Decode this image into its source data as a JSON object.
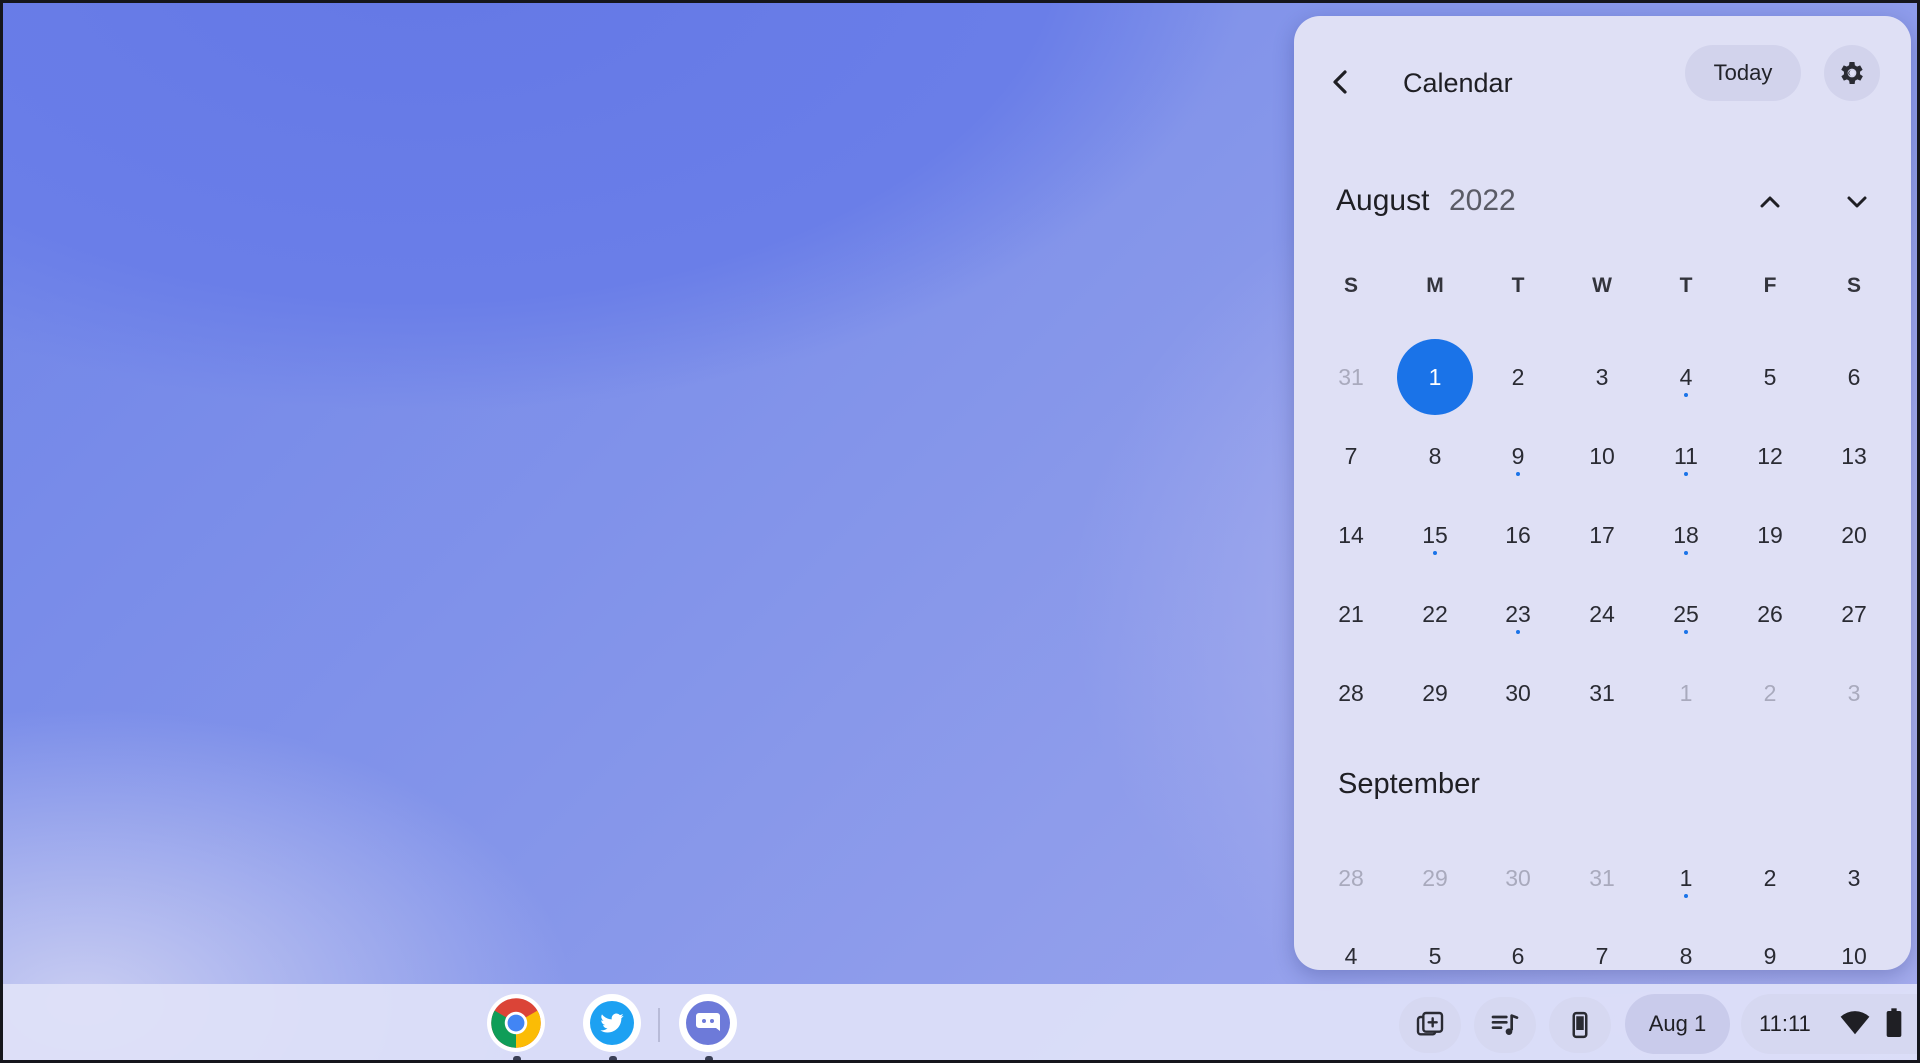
{
  "calendar": {
    "back_icon": "chevron-left-icon",
    "title": "Calendar",
    "today_label": "Today",
    "settings_icon": "gear-icon",
    "month": "August",
    "year": "2022",
    "prev_icon": "chevron-up-icon",
    "next_icon": "chevron-down-icon",
    "days_of_week": [
      "S",
      "M",
      "T",
      "W",
      "T",
      "F",
      "S"
    ],
    "august_weeks": [
      [
        {
          "d": "31",
          "muted": true
        },
        {
          "d": "1",
          "selected": true
        },
        {
          "d": "2"
        },
        {
          "d": "3"
        },
        {
          "d": "4",
          "event": true
        },
        {
          "d": "5"
        },
        {
          "d": "6"
        }
      ],
      [
        {
          "d": "7"
        },
        {
          "d": "8"
        },
        {
          "d": "9",
          "event": true
        },
        {
          "d": "10"
        },
        {
          "d": "11",
          "event": true
        },
        {
          "d": "12"
        },
        {
          "d": "13"
        }
      ],
      [
        {
          "d": "14"
        },
        {
          "d": "15",
          "event": true
        },
        {
          "d": "16"
        },
        {
          "d": "17"
        },
        {
          "d": "18",
          "event": true
        },
        {
          "d": "19"
        },
        {
          "d": "20"
        }
      ],
      [
        {
          "d": "21"
        },
        {
          "d": "22"
        },
        {
          "d": "23",
          "event": true
        },
        {
          "d": "24"
        },
        {
          "d": "25",
          "event": true
        },
        {
          "d": "26"
        },
        {
          "d": "27"
        }
      ],
      [
        {
          "d": "28"
        },
        {
          "d": "29"
        },
        {
          "d": "30"
        },
        {
          "d": "31"
        },
        {
          "d": "1",
          "muted": true
        },
        {
          "d": "2",
          "muted": true
        },
        {
          "d": "3",
          "muted": true
        }
      ]
    ],
    "next_month": "September",
    "september_weeks": [
      [
        {
          "d": "28",
          "muted": true
        },
        {
          "d": "29",
          "muted": true
        },
        {
          "d": "30",
          "muted": true
        },
        {
          "d": "31",
          "muted": true
        },
        {
          "d": "1",
          "event": true
        },
        {
          "d": "2"
        },
        {
          "d": "3"
        }
      ],
      [
        {
          "d": "4"
        },
        {
          "d": "5"
        },
        {
          "d": "6",
          "event": true
        },
        {
          "d": "7"
        },
        {
          "d": "8",
          "event": true
        },
        {
          "d": "9"
        },
        {
          "d": "10"
        }
      ]
    ],
    "accent_color": "#1a73e8"
  },
  "shelf": {
    "apps": [
      {
        "name": "Chrome",
        "icon": "chrome-icon"
      },
      {
        "name": "Twitter",
        "icon": "twitter-icon"
      },
      {
        "name": "Discord",
        "icon": "discord-icon"
      }
    ],
    "tray": {
      "screen_capture_icon": "screen-capture-icon",
      "media_controls_icon": "media-controls-icon",
      "phone_hub_icon": "phone-icon",
      "date": "Aug 1",
      "time": "11:11",
      "wifi_icon": "wifi-icon",
      "battery_icon": "battery-icon"
    }
  }
}
